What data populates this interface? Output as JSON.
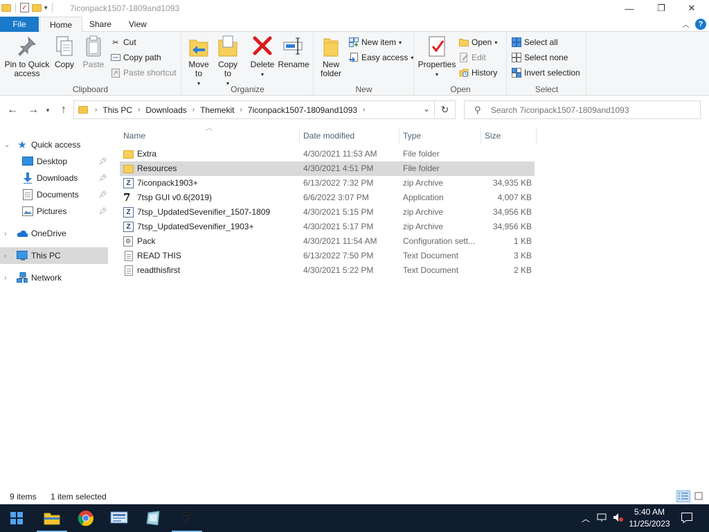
{
  "window": {
    "title": "7iconpack1507-1809and1093",
    "minimize": "—",
    "maximize": "❐",
    "close": "✕"
  },
  "ribbon_tabs": {
    "file": "File",
    "home": "Home",
    "share": "Share",
    "view": "View",
    "help": "?"
  },
  "ribbon": {
    "clipboard": {
      "label": "Clipboard",
      "pin": "Pin to Quick access",
      "copy": "Copy",
      "paste": "Paste",
      "cut": "Cut",
      "copy_path": "Copy path",
      "paste_shortcut": "Paste shortcut"
    },
    "organize": {
      "label": "Organize",
      "move_to": "Move to",
      "copy_to": "Copy to",
      "delete": "Delete",
      "rename": "Rename"
    },
    "new": {
      "label": "New",
      "new_folder": "New folder",
      "new_item": "New item",
      "easy_access": "Easy access"
    },
    "open": {
      "label": "Open",
      "properties": "Properties",
      "open": "Open",
      "edit": "Edit",
      "history": "History"
    },
    "select": {
      "label": "Select",
      "select_all": "Select all",
      "select_none": "Select none",
      "invert": "Invert selection"
    }
  },
  "address": {
    "crumbs": [
      "This PC",
      "Downloads",
      "Themekit",
      "7iconpack1507-1809and1093"
    ],
    "search_placeholder": "Search 7iconpack1507-1809and1093"
  },
  "nav": {
    "quick_access": "Quick access",
    "desktop": "Desktop",
    "downloads": "Downloads",
    "documents": "Documents",
    "pictures": "Pictures",
    "onedrive": "OneDrive",
    "this_pc": "This PC",
    "network": "Network"
  },
  "columns": {
    "name": "Name",
    "date": "Date modified",
    "type": "Type",
    "size": "Size"
  },
  "files": [
    {
      "name": "Extra",
      "date": "4/30/2021 11:53 AM",
      "type": "File folder",
      "size": "",
      "icon": "folder-icon"
    },
    {
      "name": "Resources",
      "date": "4/30/2021 4:51 PM",
      "type": "File folder",
      "size": "",
      "icon": "folder-icon"
    },
    {
      "name": "7iconpack1903+",
      "date": "6/13/2022 7:32 PM",
      "type": "zip Archive",
      "size": "34,935 KB",
      "icon": "zip-icon"
    },
    {
      "name": "7tsp GUI v0.6(2019)",
      "date": "6/6/2022 3:07 PM",
      "type": "Application",
      "size": "4,007 KB",
      "icon": "app-icon"
    },
    {
      "name": "7tsp_UpdatedSevenifier_1507-1809",
      "date": "4/30/2021 5:15 PM",
      "type": "zip Archive",
      "size": "34,956 KB",
      "icon": "zip-icon"
    },
    {
      "name": "7tsp_UpdatedSevenifier_1903+",
      "date": "4/30/2021 5:17 PM",
      "type": "zip Archive",
      "size": "34,956 KB",
      "icon": "zip-icon"
    },
    {
      "name": "Pack",
      "date": "4/30/2021 11:54 AM",
      "type": "Configuration sett...",
      "size": "1 KB",
      "icon": "config-icon"
    },
    {
      "name": "READ THIS",
      "date": "6/13/2022 7:50 PM",
      "type": "Text Document",
      "size": "3 KB",
      "icon": "text-document-icon"
    },
    {
      "name": "readthisfirst",
      "date": "4/30/2021 5:22 PM",
      "type": "Text Document",
      "size": "2 KB",
      "icon": "text-document-icon"
    }
  ],
  "status": {
    "items": "9 items",
    "selected": "1 item selected"
  },
  "taskbar": {
    "time": "5:40 AM",
    "date": "11/25/2023"
  }
}
